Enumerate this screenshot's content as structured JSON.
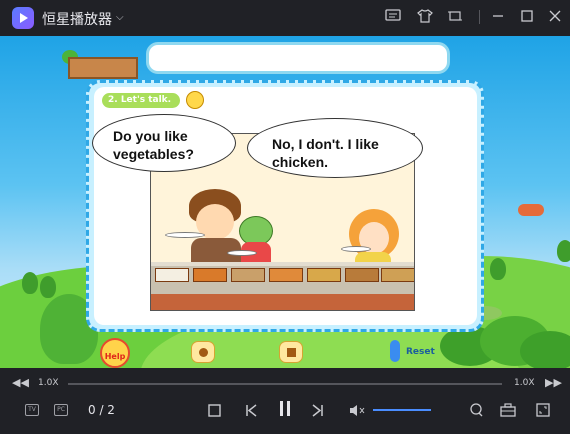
{
  "app": {
    "title": "恒星播放器"
  },
  "titlebar": {
    "icons": [
      "subtitle-icon",
      "skin-icon",
      "mini-mode-icon",
      "minimize-icon",
      "maximize-icon",
      "close-icon"
    ]
  },
  "video": {
    "lesson_tag": "2. Let's talk.",
    "bubble_boy": [
      "Do you like",
      "vegetables?"
    ],
    "bubble_girl": [
      "No, I don't. I like",
      "chicken."
    ],
    "help_label": "Help",
    "reset_label": "Reset"
  },
  "controls": {
    "speed_left": "1.0X",
    "speed_right": "1.0X",
    "page_count": "0 / 2",
    "tv_label": "TV",
    "pc_label": "PC",
    "progress_fraction": 0.0,
    "volume_fraction": 1.0
  },
  "colors": {
    "titlebar_bg": "#202126",
    "accent": "#4a8dff",
    "board_border": "#2fa8e6",
    "lesson_tag": "#a9de5a"
  }
}
